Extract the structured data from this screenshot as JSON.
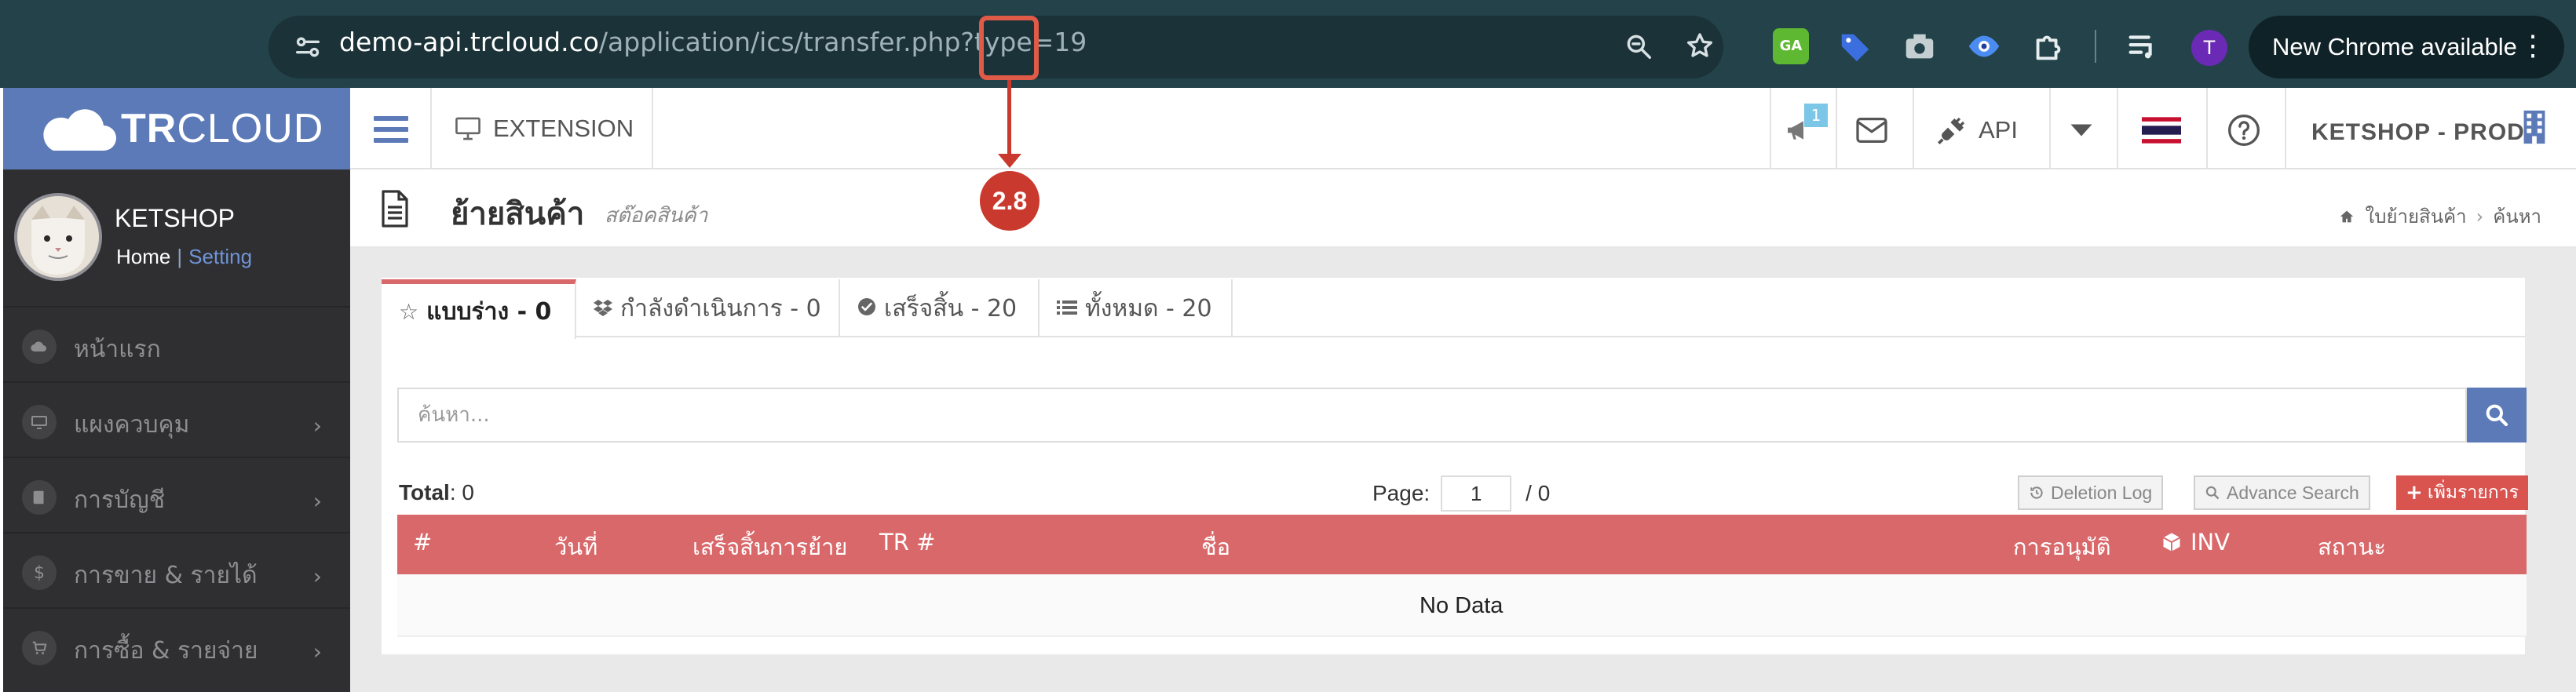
{
  "browser": {
    "url_host": "demo-api.trcloud.co",
    "url_path": "/application/ics/transfer.php?type=19",
    "update_label": "New Chrome available",
    "profile_initial": "T",
    "extension_ga_label": "GA"
  },
  "brand": {
    "name_bold": "TR",
    "name_thin": "CLOUD"
  },
  "profile": {
    "name": "KETSHOP",
    "home_link": "Home",
    "separator": "|",
    "setting_link": "Setting"
  },
  "sidebar": {
    "items": [
      {
        "label": "หน้าแรก",
        "icon": "cloud-icon",
        "has_children": false
      },
      {
        "label": "แผงควบคุม",
        "icon": "monitor-icon",
        "has_children": true
      },
      {
        "label": "การบัญชี",
        "icon": "book-icon",
        "has_children": true
      },
      {
        "label": "การขาย & รายได้",
        "icon": "dollar-icon",
        "has_children": true
      },
      {
        "label": "การซื้อ & รายจ่าย",
        "icon": "cart-icon",
        "has_children": true
      }
    ]
  },
  "header": {
    "extension_label": "EXTENSION",
    "notification_count": "1",
    "api_label": "API",
    "company_label": "KETSHOP - PROD"
  },
  "page": {
    "title": "ย้ายสินค้า",
    "subtitle": "สต๊อคสินค้า",
    "breadcrumb": [
      "ใบย้ายสินค้า",
      "ค้นหา"
    ]
  },
  "tabs": [
    {
      "label": "แบบร่าง - 0",
      "icon": "star-icon",
      "active": true
    },
    {
      "label": "กำลังดำเนินการ - 0",
      "icon": "dropbox-icon",
      "active": false
    },
    {
      "label": "เสร็จสิ้น - 20",
      "icon": "check-circle-icon",
      "active": false
    },
    {
      "label": "ทั้งหมด - 20",
      "icon": "list-icon",
      "active": false
    }
  ],
  "search": {
    "placeholder": "ค้นหา...",
    "value": ""
  },
  "summary": {
    "total_label": "Total",
    "total_value": "0"
  },
  "pagination": {
    "label": "Page:",
    "current": "1",
    "total_text": "/ 0"
  },
  "actions": {
    "deletion_log": "Deletion Log",
    "advance_search": "Advance Search",
    "add": "เพิ่มรายการ"
  },
  "table": {
    "columns": [
      "#",
      "วันที่",
      "เสร็จสิ้นการย้าย",
      "TR #",
      "ชื่อ",
      "การอนุมัติ",
      "INV",
      "สถานะ"
    ],
    "empty_text": "No Data"
  },
  "annotation": {
    "label": "2.8"
  },
  "colors": {
    "chrome_bg": "#23424a",
    "brand_blue": "#5c7ab8",
    "sidebar_bg": "#2f2f31",
    "table_header": "#d9686a",
    "add_button": "#d9534f",
    "annotation_red": "#c9392d"
  }
}
